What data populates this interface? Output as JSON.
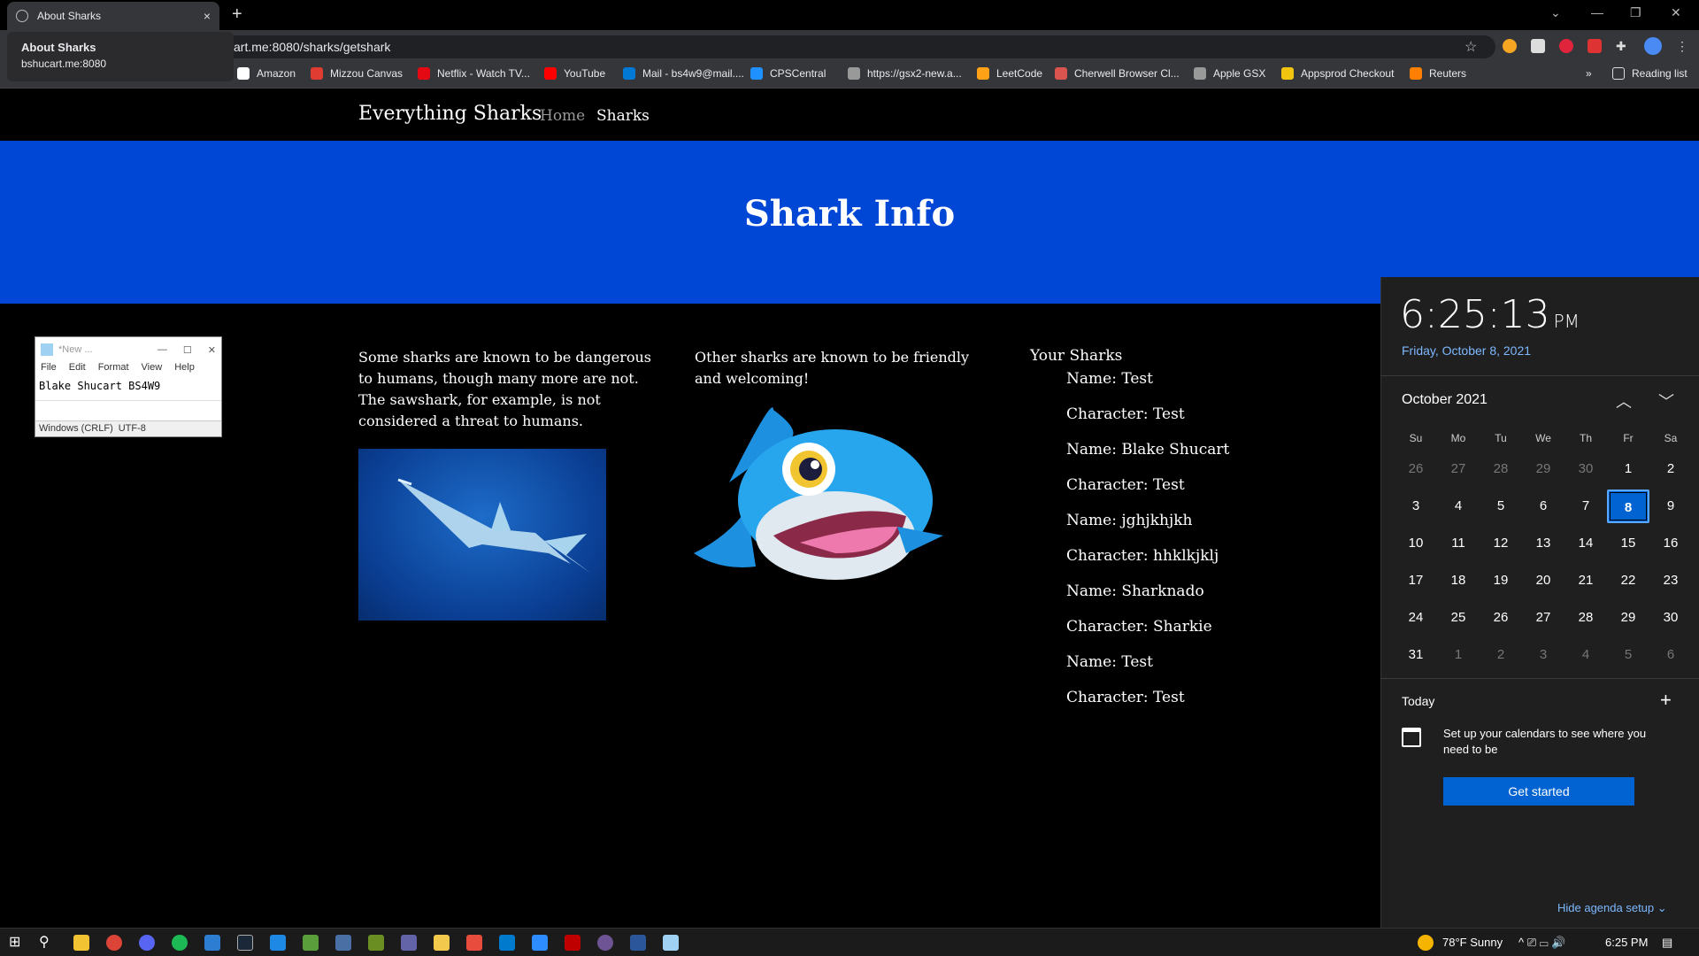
{
  "browser": {
    "tab_title": "About Sharks",
    "tab_close": "×",
    "new_tab": "+",
    "tooltip_title": "About Sharks",
    "tooltip_host": "bshucart.me:8080",
    "url": "art.me:8080/sharks/getshark",
    "bookmarks": [
      {
        "label": "Amazon",
        "color": "#ffffff"
      },
      {
        "label": "Mizzou Canvas",
        "color": "#e03c31"
      },
      {
        "label": "Netflix - Watch TV...",
        "color": "#e50914"
      },
      {
        "label": "YouTube",
        "color": "#ff0000"
      },
      {
        "label": "Mail - bs4w9@mail....",
        "color": "#0078d4"
      },
      {
        "label": "CPSCentral",
        "color": "#1e90ff"
      },
      {
        "label": "https://gsx2-new.a...",
        "color": "#999999"
      },
      {
        "label": "LeetCode",
        "color": "#ffa116"
      },
      {
        "label": "Cherwell Browser Cl...",
        "color": "#d9534f"
      },
      {
        "label": "Apple GSX",
        "color": "#999999"
      },
      {
        "label": "Appsprod Checkout",
        "color": "#f1c40f"
      },
      {
        "label": "Reuters",
        "color": "#ff8000"
      }
    ],
    "more_bookmarks": "»",
    "reading_list": "Reading list"
  },
  "site": {
    "brand": "Everything Sharks",
    "nav": [
      "Home",
      "Sharks"
    ],
    "hero_title": "Shark Info",
    "col1_text": "Some sharks are known to be dangerous to humans, though many more are not. The sawshark, for example, is not considered a threat to humans.",
    "col2_text": "Other sharks are known to be friendly and welcoming!",
    "your_sharks_heading": "Your Sharks",
    "sharks": [
      "Name: Test",
      "Character: Test",
      "Name: Blake Shucart",
      "Character: Test",
      "Name: jghjkhjkh",
      "Character: hhklkjklj",
      "Name: Sharknado",
      "Character: Sharkie",
      "Name: Test",
      "Character: Test"
    ]
  },
  "notepad": {
    "title": "*New ...",
    "menu": [
      "File",
      "Edit",
      "Format",
      "View",
      "Help"
    ],
    "content": "Blake Shucart BS4W9",
    "status_eol": "Windows (CRLF)",
    "status_enc": "UTF-8"
  },
  "clock_panel": {
    "time": "6:25:13",
    "ampm": "PM",
    "date": "Friday, October 8, 2021",
    "month": "October 2021",
    "dow": [
      "Su",
      "Mo",
      "Tu",
      "We",
      "Th",
      "Fr",
      "Sa"
    ],
    "weeks": [
      [
        "26",
        "27",
        "28",
        "29",
        "30",
        "1",
        "2"
      ],
      [
        "3",
        "4",
        "5",
        "6",
        "7",
        "8",
        "9"
      ],
      [
        "10",
        "11",
        "12",
        "13",
        "14",
        "15",
        "16"
      ],
      [
        "17",
        "18",
        "19",
        "20",
        "21",
        "22",
        "23"
      ],
      [
        "24",
        "25",
        "26",
        "27",
        "28",
        "29",
        "30"
      ],
      [
        "31",
        "1",
        "2",
        "3",
        "4",
        "5",
        "6"
      ]
    ],
    "selected_day": "8",
    "today_label": "Today",
    "add": "+",
    "setup_text": "Set up your calendars to see where you need to be",
    "get_started": "Get started",
    "hide_agenda": "Hide agenda setup"
  },
  "taskbar": {
    "weather": "78°F  Sunny",
    "time": "6:25 PM"
  },
  "colors": {
    "hero": "#0047d6",
    "accent": "#0063d1"
  }
}
